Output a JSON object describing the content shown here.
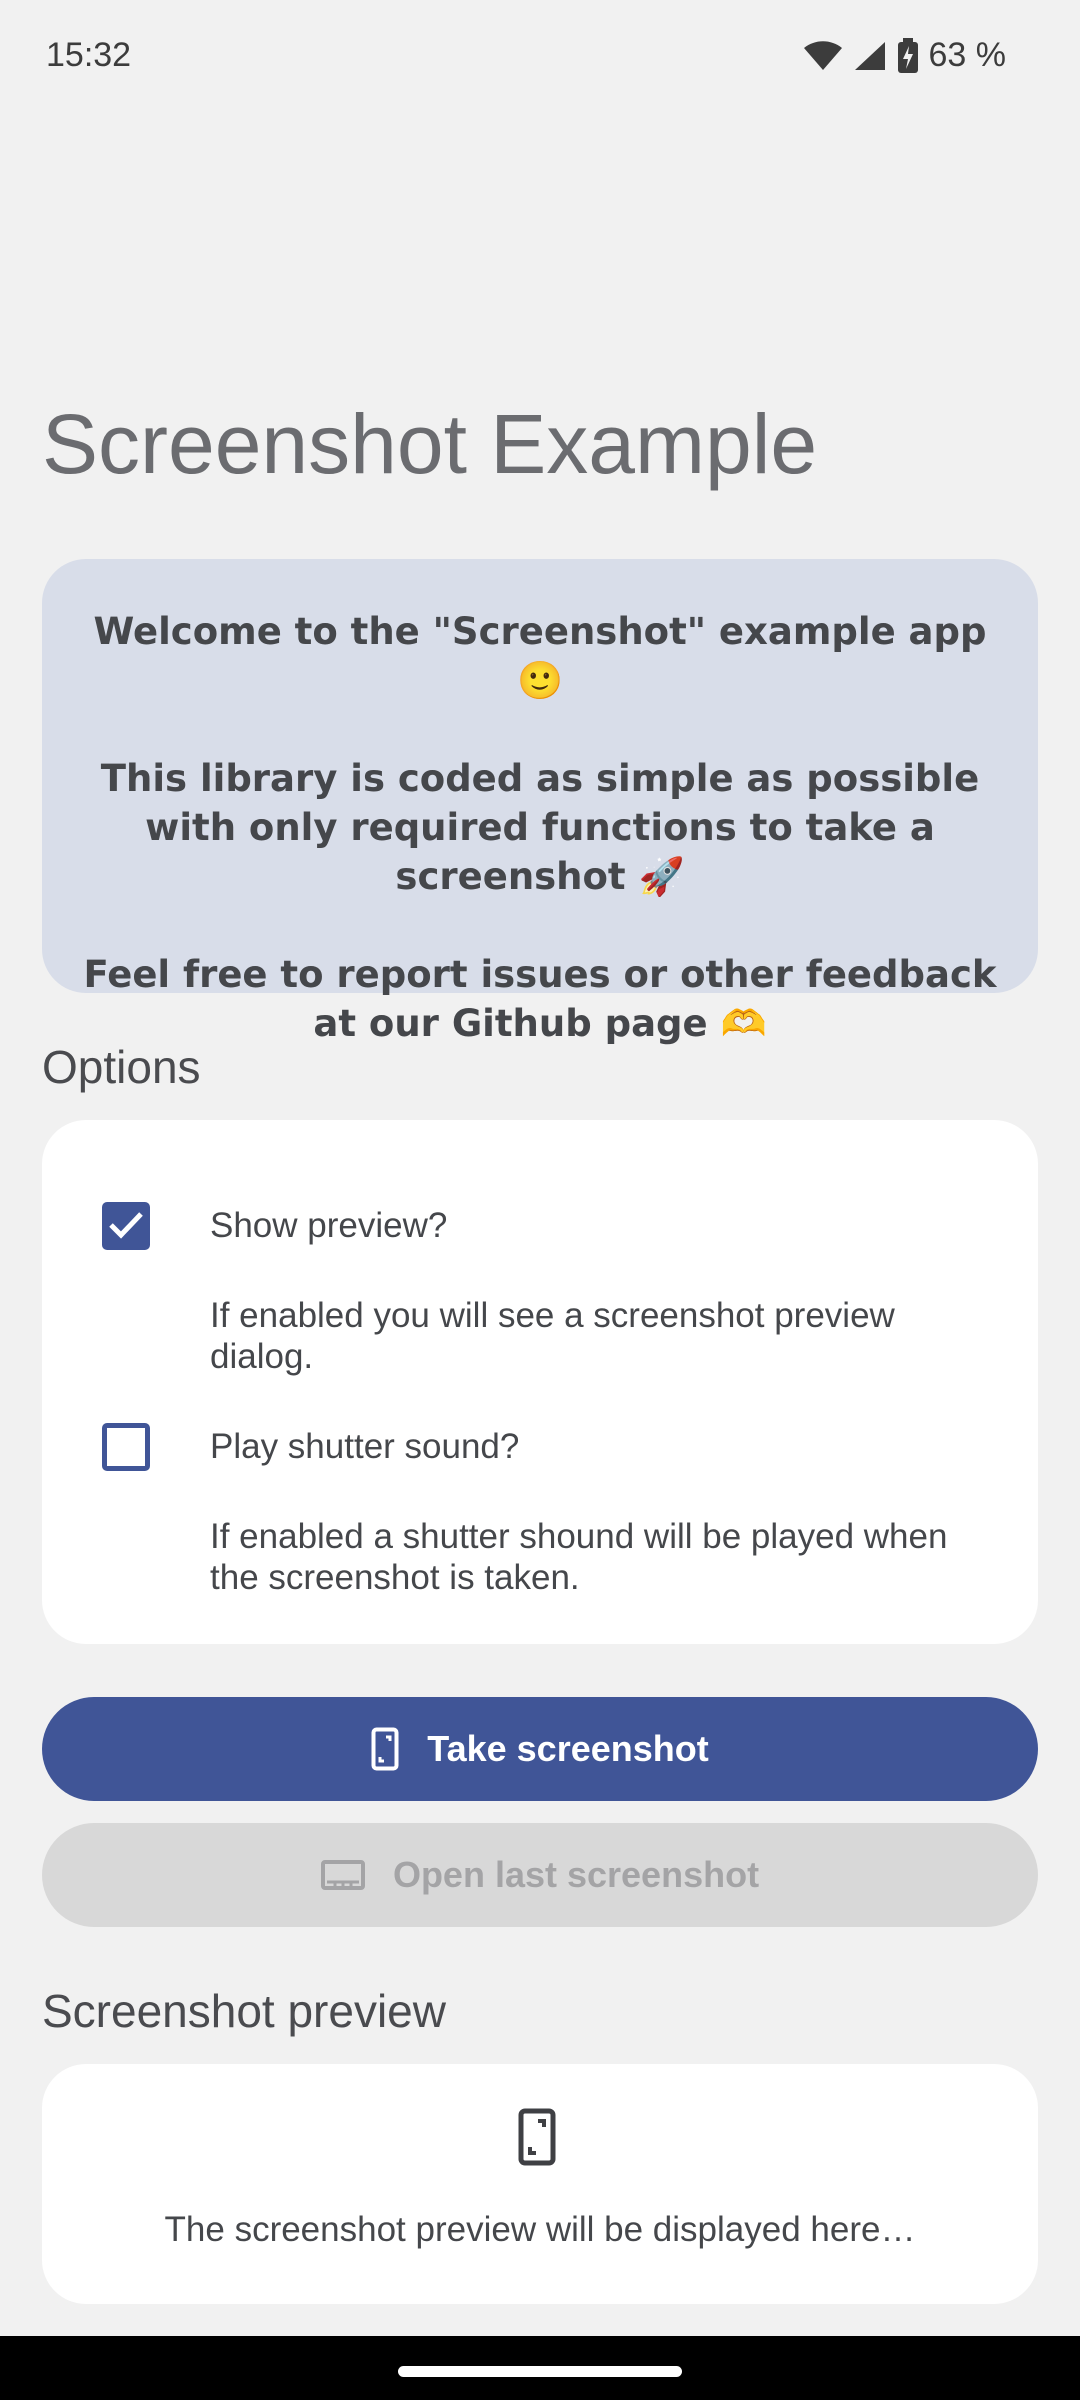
{
  "status_bar": {
    "time": "15:32",
    "battery": "63 %",
    "icons": [
      "wifi-icon",
      "signal-icon",
      "battery-charging-icon"
    ]
  },
  "page": {
    "title": "Screenshot Example"
  },
  "welcome": {
    "line1": "Welcome to the \"Screenshot\" example app 🙂",
    "line2": "This library is coded as simple as possible with only required functions to take a screenshot 🚀",
    "line3": "Feel free to report issues or other feedback at our Github page 🫶"
  },
  "options": {
    "heading": "Options",
    "items": [
      {
        "label": "Show preview?",
        "description": "If enabled you will see a screenshot preview dialog.",
        "checked": true
      },
      {
        "label": "Play shutter sound?",
        "description": "If enabled a shutter shound will be played when the screenshot is taken.",
        "checked": false
      }
    ]
  },
  "actions": {
    "take_screenshot": "Take screenshot",
    "open_last_screenshot": "Open last screenshot",
    "open_last_enabled": false
  },
  "preview": {
    "heading": "Screenshot preview",
    "placeholder": "The screenshot preview will be displayed here…"
  },
  "colors": {
    "accent": "#405597",
    "background": "#f1f1f1",
    "welcome_card": "#d8dde9",
    "disabled_button": "#d8d8d8"
  }
}
